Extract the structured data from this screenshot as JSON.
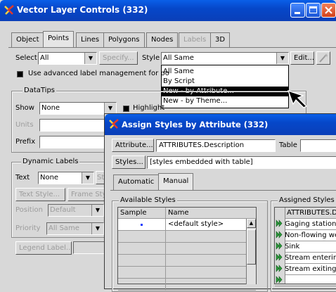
{
  "main_window": {
    "title": "Vector Layer Controls (332)",
    "tabs": [
      {
        "label": "Object",
        "state": "normal"
      },
      {
        "label": "Points",
        "state": "active"
      },
      {
        "label": "Lines",
        "state": "normal"
      },
      {
        "label": "Polygons",
        "state": "normal"
      },
      {
        "label": "Nodes",
        "state": "normal"
      },
      {
        "label": "Labels",
        "state": "disabled"
      },
      {
        "label": "3D",
        "state": "normal"
      }
    ],
    "select_label": "Select",
    "select_value": "All",
    "specify_button": "Specify...",
    "style_label": "Style",
    "style_value": "All Same",
    "edit_button": "Edit...",
    "advanced_label_checkbox": "Use advanced label management for po",
    "style_dropdown": {
      "options": [
        "All Same",
        "By Script",
        "New - by Attribute...",
        "New - by Theme..."
      ],
      "selected": "New - by Attribute..."
    },
    "datatips": {
      "title": "DataTips",
      "show_label": "Show",
      "show_value": "None",
      "highlight_checkbox": "Highlight",
      "units_label": "Units",
      "prefix_label": "Prefix"
    },
    "dynamic_labels": {
      "title": "Dynamic Labels",
      "text_label": "Text",
      "text_value": "None",
      "text_style_button": "Text Style...",
      "frame_style_button": "Frame Style...",
      "position_label": "Position",
      "position_value": "Default",
      "priority_label": "Priority",
      "priority_value": "All Same"
    },
    "legend_label_button": "Legend Label..."
  },
  "dialog": {
    "title": "Assign Styles by Attribute (332)",
    "attribute_button": "Attribute...",
    "attribute_value": "ATTRIBUTES.Description",
    "table_label": "Table",
    "styles_button": "Styles...",
    "styles_value": "[styles embedded with table]",
    "tabs": [
      {
        "label": "Automatic",
        "state": "normal"
      },
      {
        "label": "Manual",
        "state": "active"
      }
    ],
    "available_styles": {
      "title": "Available Styles",
      "columns": [
        "Sample",
        "Name"
      ],
      "rows": [
        "<default style>",
        "",
        "",
        "",
        "",
        "",
        ""
      ]
    },
    "assigned_styles": {
      "title": "Assigned Styles",
      "header": "ATTRIBUTES.D",
      "rows": [
        "Gaging station",
        "Non-flowing we",
        "Sink",
        "Stream enterin",
        "Stream exiting",
        ""
      ]
    }
  },
  "colors": {
    "titlebar_blue": "#0647c9",
    "window_face": "#d8d8d8",
    "close_red": "#d3421a",
    "assign_arrow_green": "#2a9a3a",
    "sample_dot_blue": "#1a3cff"
  }
}
